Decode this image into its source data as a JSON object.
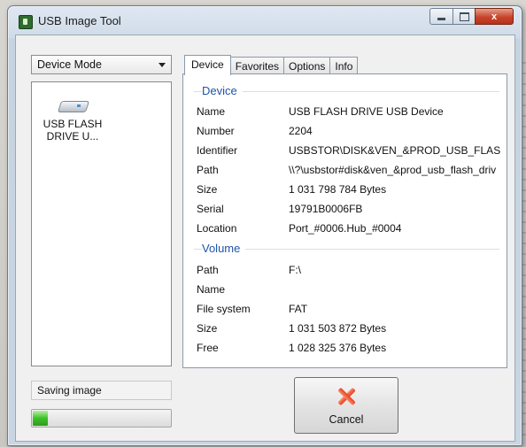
{
  "window": {
    "title": "USB Image Tool"
  },
  "controls": {
    "close_label": "x"
  },
  "mode_select": {
    "value": "Device Mode"
  },
  "device_list": [
    {
      "label": "USB FLASH DRIVE U...",
      "icon": "usb-drive-icon"
    }
  ],
  "tabs": [
    {
      "label": "Device",
      "active": true
    },
    {
      "label": "Favorites",
      "active": false
    },
    {
      "label": "Options",
      "active": false
    },
    {
      "label": "Info",
      "active": false
    }
  ],
  "device_group": {
    "title": "Device",
    "rows": [
      {
        "key": "Name",
        "value": "USB FLASH DRIVE USB Device"
      },
      {
        "key": "Number",
        "value": "2204"
      },
      {
        "key": "Identifier",
        "value": "USBSTOR\\DISK&VEN_&PROD_USB_FLAS"
      },
      {
        "key": "Path",
        "value": "\\\\?\\usbstor#disk&ven_&prod_usb_flash_driv"
      },
      {
        "key": "Size",
        "value": "1 031 798 784 Bytes"
      },
      {
        "key": "Serial",
        "value": "19791B0006FB"
      },
      {
        "key": "Location",
        "value": "Port_#0006.Hub_#0004"
      }
    ]
  },
  "volume_group": {
    "title": "Volume",
    "rows": [
      {
        "key": "Path",
        "value": "F:\\"
      },
      {
        "key": "Name",
        "value": ""
      },
      {
        "key": "File system",
        "value": "FAT"
      },
      {
        "key": "Size",
        "value": "1 031 503 872 Bytes"
      },
      {
        "key": "Free",
        "value": "1 028 325 376 Bytes"
      }
    ]
  },
  "status": {
    "text": "Saving image",
    "progress": 0.12,
    "progress_color": "#3fc12b"
  },
  "cancel_button": {
    "label": "Cancel",
    "icon": "cancel-x-icon"
  }
}
